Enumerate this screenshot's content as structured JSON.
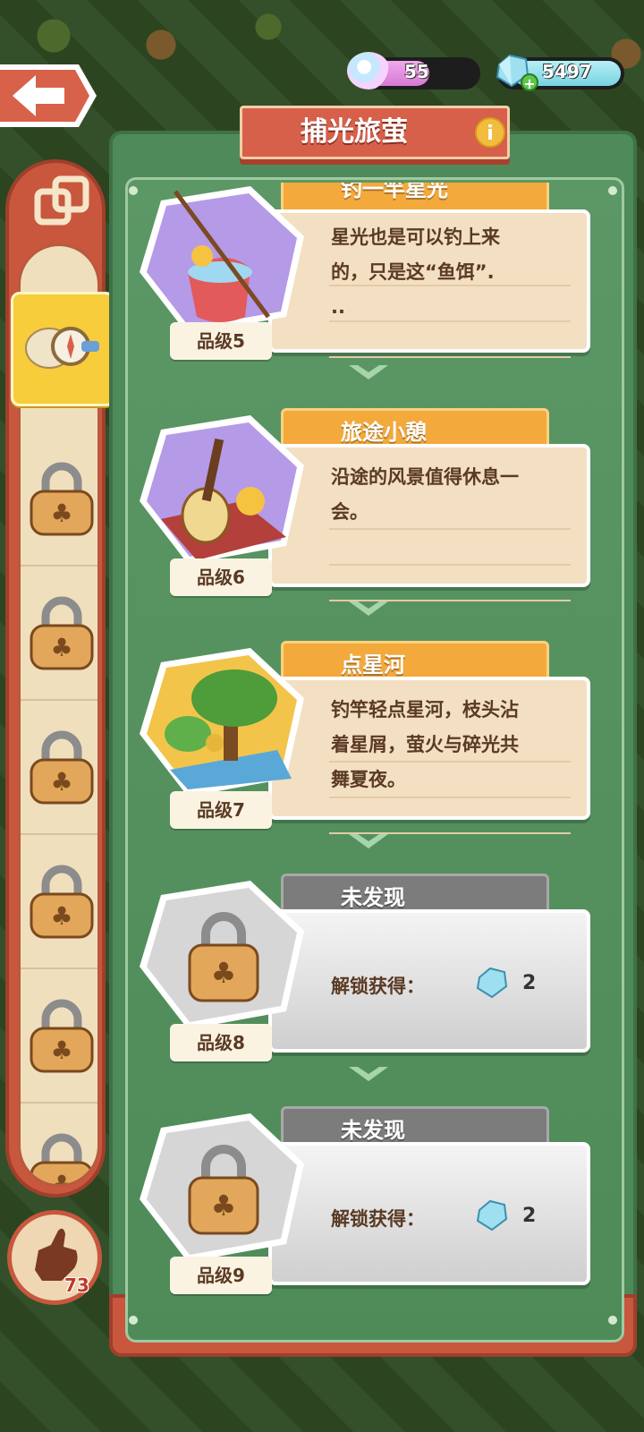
{
  "header": {
    "title": "捕光旅萤",
    "info_icon": "i",
    "back_icon": "arrow-left"
  },
  "currency": {
    "rainbow_value": "55",
    "gem_value": "5497"
  },
  "sidebar": {
    "hand_count": "73",
    "slots": [
      "compass",
      "locked",
      "locked",
      "locked",
      "locked",
      "locked",
      "locked"
    ]
  },
  "entries": [
    {
      "name": "钓一竿星光",
      "desc_lines": [
        "星光也是可以钓上来",
        "的，只是这“鱼饵”.",
        ".."
      ],
      "grade": "品级5",
      "state": "unlocked",
      "art": "fishing-bucket"
    },
    {
      "name": "旅途小憩",
      "desc_lines": [
        "沿途的风景值得休息一",
        "会。"
      ],
      "grade": "品级6",
      "state": "unlocked",
      "art": "guitar-picnic"
    },
    {
      "name": "点星河",
      "desc_lines": [
        "钓竿轻点星河，枝头沾",
        "着星屑，萤火与碎光共",
        "舞夏夜。"
      ],
      "grade": "品级7",
      "state": "unlocked",
      "art": "tree-river"
    },
    {
      "name": "未发现",
      "unlock_label": "解锁获得：",
      "unlock_count": "2",
      "grade": "品级8",
      "state": "locked",
      "art": "lock"
    },
    {
      "name": "未发现",
      "unlock_label": "解锁获得：",
      "unlock_count": "2",
      "grade": "品级9",
      "state": "locked",
      "art": "lock"
    }
  ]
}
